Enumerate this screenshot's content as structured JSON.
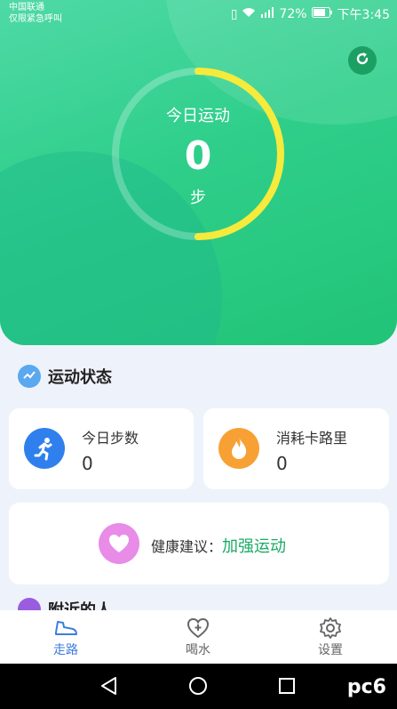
{
  "status_bar": {
    "carrier_line1": "中国联通",
    "carrier_line2": "仅限紧急呼叫",
    "battery": "72%",
    "time": "下午3:45"
  },
  "hero": {
    "label": "今日运动",
    "steps_value": "0",
    "unit": "步",
    "progress_fraction": 0.5,
    "colors": {
      "ring_progress": "#f6ea3b",
      "ring_track": "rgba(255,255,255,0.25)"
    }
  },
  "section": {
    "title": "运动状态"
  },
  "stats": [
    {
      "label": "今日步数",
      "value": "0",
      "icon": "running-icon",
      "color": "#2f80ed"
    },
    {
      "label": "消耗卡路里",
      "value": "0",
      "icon": "flame-icon",
      "color": "#f7a134"
    }
  ],
  "advice": {
    "label": "健康建议：",
    "value": "加强运动",
    "icon": "heart-icon"
  },
  "peek_section": {
    "title": "附近的人"
  },
  "nav": [
    {
      "label": "走路",
      "icon": "shoe-icon",
      "active": true
    },
    {
      "label": "喝水",
      "icon": "heart-plus-icon",
      "active": false
    },
    {
      "label": "设置",
      "icon": "gear-icon",
      "active": false
    }
  ],
  "watermark": "pc6"
}
